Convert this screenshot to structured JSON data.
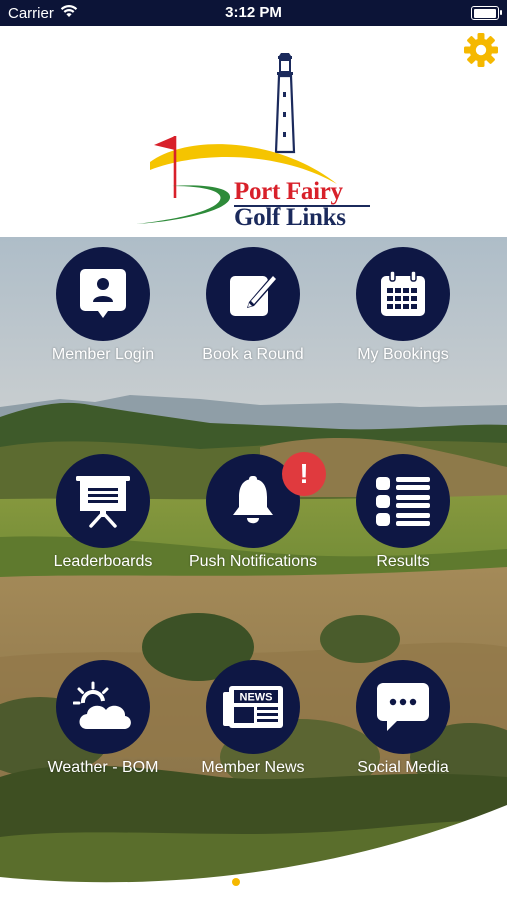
{
  "status_bar": {
    "carrier": "Carrier",
    "time": "3:12 PM",
    "battery_level": 1.0
  },
  "header": {
    "logo_line1": "Port Fairy",
    "logo_line2": "Golf Links",
    "settings_icon": "gear-icon",
    "settings_color": "#f5b800"
  },
  "colors": {
    "tile_background": "#0e1744",
    "badge": "#e03a3e",
    "brand_red": "#d8202a",
    "brand_navy": "#1b2a5c"
  },
  "tiles": [
    {
      "label": "Member Login",
      "icon": "member-id-icon"
    },
    {
      "label": "Book a Round",
      "icon": "edit-pencil-icon"
    },
    {
      "label": "My Bookings",
      "icon": "calendar-icon"
    },
    {
      "label": "Leaderboards",
      "icon": "presentation-board-icon"
    },
    {
      "label": "Push Notifications",
      "icon": "bell-icon",
      "badge": "!"
    },
    {
      "label": "Results",
      "icon": "list-icon"
    },
    {
      "label": "Weather - BOM",
      "icon": "partly-cloudy-icon"
    },
    {
      "label": "Member News",
      "icon": "newspaper-icon",
      "icon_text": "NEWS"
    },
    {
      "label": "Social Media",
      "icon": "chat-bubble-icon"
    }
  ],
  "pager": {
    "pages": 1,
    "current": 1
  }
}
